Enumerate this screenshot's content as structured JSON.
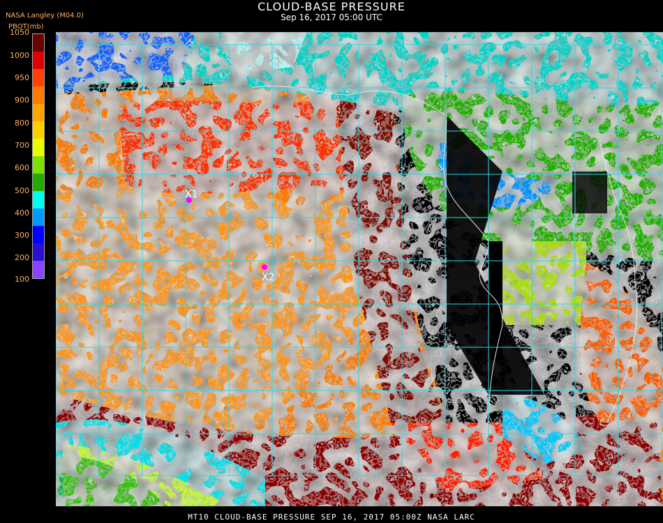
{
  "header": {
    "title": "CLOUD-BASE PRESSURE",
    "subtitle": "Sep 16, 2017 05:00 UTC",
    "source": "NASA Langley (M04.0)",
    "units": "PBOT(mb)"
  },
  "legend": {
    "ticks": [
      "1050",
      "1000",
      "950",
      "900",
      "850",
      "800",
      "750",
      "700",
      "650",
      "600",
      "550",
      "500",
      "450",
      "400",
      "350",
      "300",
      "250",
      "200",
      "150",
      "100"
    ],
    "visible_labels": [
      "1050",
      "1000",
      "950",
      "900",
      "800",
      "700",
      "600",
      "500",
      "400",
      "300",
      "200",
      "100"
    ],
    "colors": [
      "#6b0000",
      "#e00000",
      "#ff4000",
      "#ff7a00",
      "#ffa500",
      "#ffd000",
      "#e8ff00",
      "#7de000",
      "#22aa00",
      "#00ffee",
      "#0099ff",
      "#0000ff",
      "#2a10d0",
      "#8844ff"
    ]
  },
  "markers": [
    {
      "label": "X1",
      "color": "#ff00ff"
    },
    {
      "label": "X2",
      "color": "#ff00ff"
    }
  ],
  "footer": {
    "text": "MT10   CLOUD-BASE PRESSURE   SEP 16, 2017 05:00Z   NASA LARC"
  },
  "map": {
    "grid_color": "#2fd6e8",
    "coast_color": "#e8e8e8",
    "background": "#000000"
  }
}
